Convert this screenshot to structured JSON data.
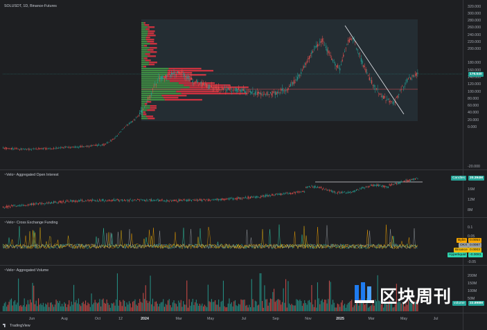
{
  "chart_header": {
    "symbol": "SOLUSDT, 1D, Binance-Futures"
  },
  "panes": {
    "price": {
      "y_ticks": [
        "320.000",
        "300.000",
        "280.000",
        "260.000",
        "240.000",
        "220.000",
        "200.000",
        "180.000",
        "160.000",
        "140.000",
        "120.000",
        "100.000",
        "80.000",
        "60.000",
        "40.000",
        "20.000",
        "0.000",
        "-20.000"
      ],
      "last_price": "176.540"
    },
    "open_interest": {
      "title": "~Velo~ Aggregated Open Interest",
      "y_ticks": [
        "16M",
        "12M",
        "8M"
      ],
      "tag_label": "Candles",
      "tag_value": "20.394M"
    },
    "funding": {
      "title": "~Velo~ Cross Exchange Funding",
      "y_ticks": [
        "0.1",
        "0.05",
        "-0.05"
      ],
      "tags": [
        {
          "label": "Bybit",
          "value": "0.0054"
        },
        {
          "label": "OKX",
          "value": "0.0087"
        },
        {
          "label": "Binance",
          "value": "0.0003"
        },
        {
          "label": "Hyperliquid",
          "value": "-0.0081"
        }
      ]
    },
    "volume": {
      "title": "~Velo~ Aggregated Volume",
      "y_ticks": [
        "200M",
        "150M",
        "100M",
        "50M"
      ],
      "tag_label": "volume",
      "tag_value": "22.898M"
    }
  },
  "x_axis": [
    "Jun",
    "Aug",
    "Oct",
    "12",
    "2024",
    "Mar",
    "May",
    "Jul",
    "Sep",
    "Nov",
    "2025",
    "Mar",
    "May",
    "Jul"
  ],
  "branding": {
    "footer": "TradingView",
    "watermark": "区块周刊"
  },
  "colors": {
    "up": "#26a69a",
    "down": "#ef5350",
    "vp_up": "#3f8a42",
    "vp_down": "#c8323f",
    "last_price": "#26a69a",
    "oi_tag": "#26a69a",
    "bybit": "#f7a600",
    "okx": "#9aa0a6",
    "binance": "#f0b90b",
    "hyperliquid": "#2fd6b0",
    "volume_tag": "#26a69a",
    "watermark_blue": "#1e7bf0"
  }
}
